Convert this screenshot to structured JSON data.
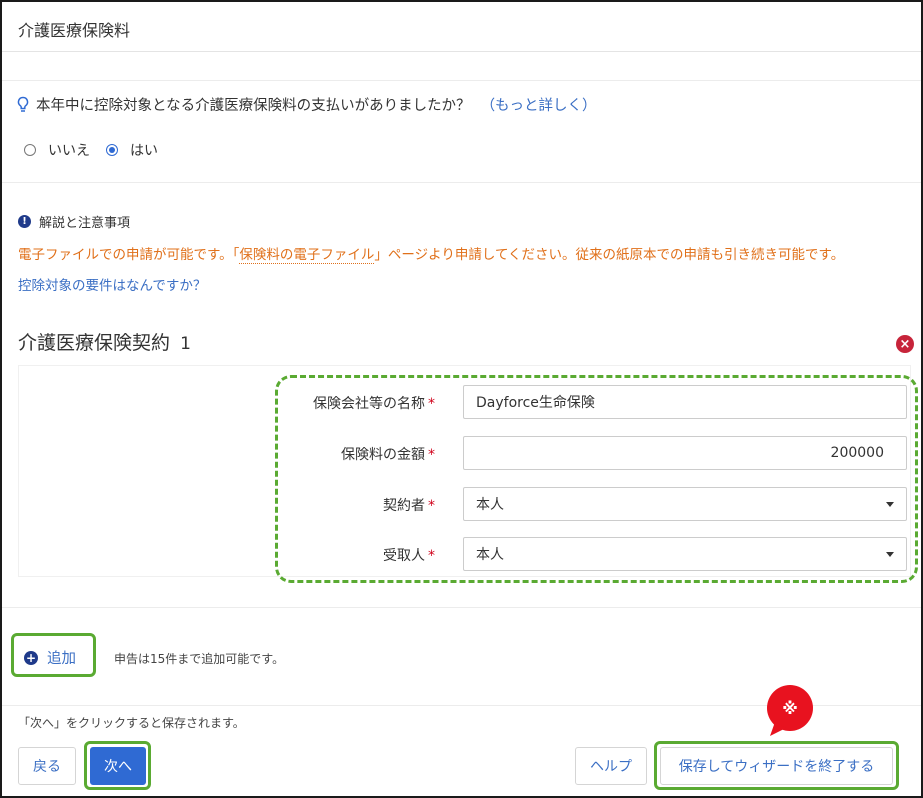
{
  "header": {
    "title": "介護医療保険料"
  },
  "question": {
    "text": "本年中に控除対象となる介護医療保険料の支払いがありましたか？",
    "more_link": "（もっと詳しく）"
  },
  "answer": {
    "options": [
      "いいえ",
      "はい"
    ],
    "selected": "はい"
  },
  "notes": {
    "title": "解説と注意事項",
    "body_prefix": "電子ファイルでの申請が可能です。「",
    "body_link": "保険料の電子ファイル",
    "body_suffix": "」ページより申請してください。従来の紙原本での申請も引き続き可能です。",
    "requirements_link": "控除対象の要件はなんですか？"
  },
  "contract": {
    "title": "介護医療保険契約",
    "number": "1",
    "fields": {
      "company": {
        "label": "保険会社等の名称",
        "value": "Dayforce生命保険"
      },
      "amount": {
        "label": "保険料の金額",
        "value": "200000"
      },
      "contractor": {
        "label": "契約者",
        "value": "本人"
      },
      "recipient": {
        "label": "受取人",
        "value": "本人"
      }
    },
    "required_mark": "*"
  },
  "add": {
    "label": "追加",
    "note": "申告は15件まで追加可能です。"
  },
  "footer": {
    "note": "「次へ」をクリックすると保存されます。",
    "back": "戻る",
    "next": "次へ",
    "help": "ヘルプ",
    "save_exit": "保存してウィザードを終了する"
  },
  "callout": {
    "mark": "※"
  },
  "colors": {
    "accent": "#2f6ad3",
    "link": "#3b6fc4",
    "warning": "#e0701a",
    "highlight": "#5aaa32",
    "danger": "#c7243a",
    "callout": "#e8121f"
  }
}
